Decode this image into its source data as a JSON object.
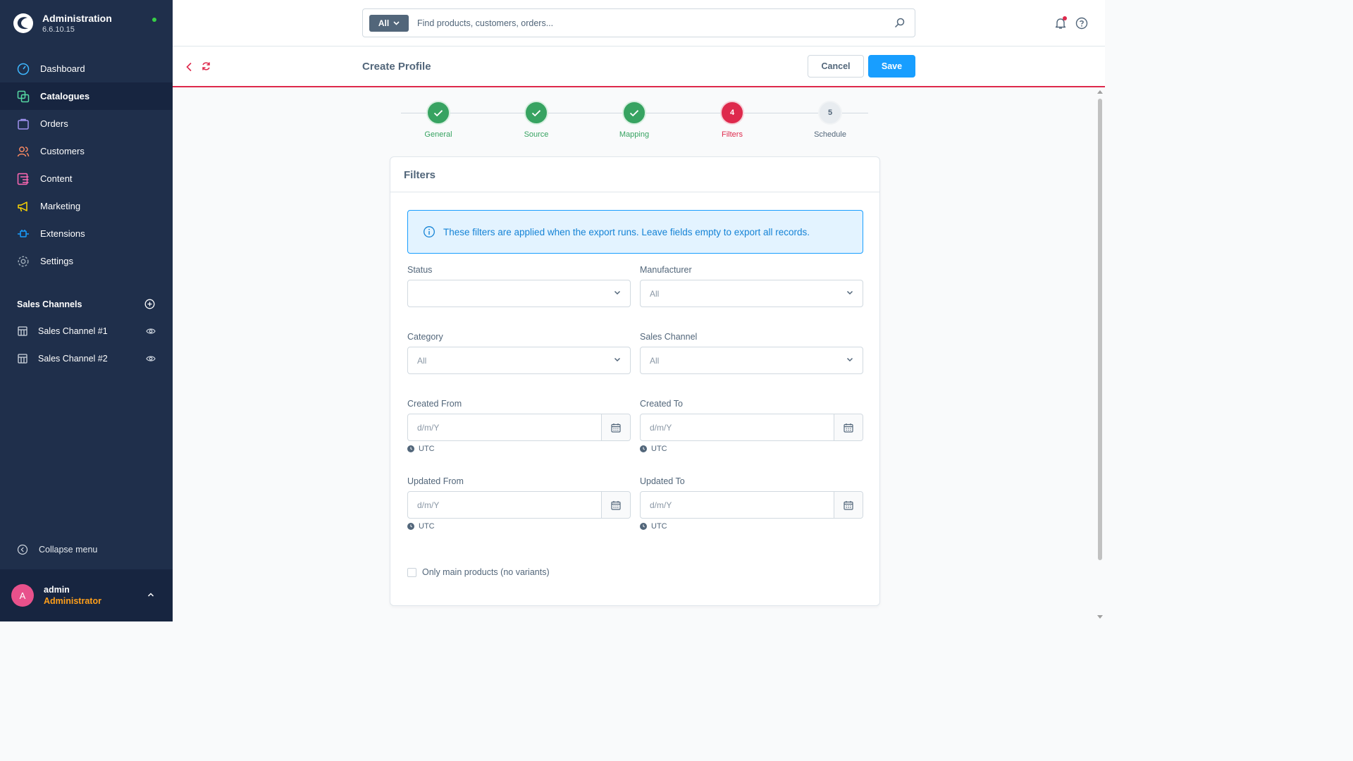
{
  "app": {
    "title": "Administration",
    "version": "6.6.10.15"
  },
  "nav": [
    {
      "label": "Dashboard",
      "icon": "dashboard-icon"
    },
    {
      "label": "Catalogues",
      "icon": "catalogue-icon"
    },
    {
      "label": "Orders",
      "icon": "orders-icon"
    },
    {
      "label": "Customers",
      "icon": "customers-icon"
    },
    {
      "label": "Content",
      "icon": "content-icon"
    },
    {
      "label": "Marketing",
      "icon": "marketing-icon"
    },
    {
      "label": "Extensions",
      "icon": "extensions-icon"
    },
    {
      "label": "Settings",
      "icon": "settings-icon"
    }
  ],
  "sales_channels": {
    "heading": "Sales Channels",
    "items": [
      {
        "label": "Sales Channel #1"
      },
      {
        "label": "Sales Channel #2"
      }
    ]
  },
  "collapse_label": "Collapse menu",
  "user": {
    "name": "admin",
    "role": "Administrator",
    "initial": "A"
  },
  "search": {
    "type": "All",
    "placeholder": "Find products, customers, orders..."
  },
  "smartbar": {
    "title": "Create Profile",
    "cancel": "Cancel",
    "save": "Save"
  },
  "steps": [
    {
      "label": "General",
      "state": "done"
    },
    {
      "label": "Source",
      "state": "done"
    },
    {
      "label": "Mapping",
      "state": "done"
    },
    {
      "label": "Filters",
      "state": "active",
      "number": "4"
    },
    {
      "label": "Schedule",
      "state": "pending",
      "number": "5"
    }
  ],
  "card": {
    "title": "Filters",
    "info": "These filters are applied when the export runs. Leave fields empty to export all records.",
    "status": {
      "label": "Status",
      "value": ""
    },
    "manufacturer": {
      "label": "Manufacturer",
      "value": "All"
    },
    "category": {
      "label": "Category",
      "value": "All"
    },
    "sales_channel": {
      "label": "Sales Channel",
      "value": "All"
    },
    "created_from": {
      "label": "Created From",
      "placeholder": "d/m/Y",
      "tz": "UTC"
    },
    "created_to": {
      "label": "Created To",
      "placeholder": "d/m/Y",
      "tz": "UTC"
    },
    "updated_from": {
      "label": "Updated From",
      "placeholder": "d/m/Y",
      "tz": "UTC"
    },
    "updated_to": {
      "label": "Updated To",
      "placeholder": "d/m/Y",
      "tz": "UTC"
    },
    "main_products": {
      "label": "Only main products (no variants)",
      "checked": false
    }
  },
  "colors": {
    "sidebar": "#1f2f4b",
    "accent": "#189eff",
    "danger": "#de294c",
    "success": "#37a361"
  }
}
